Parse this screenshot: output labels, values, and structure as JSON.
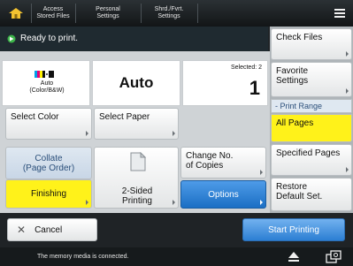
{
  "topbar": {
    "tabs": [
      {
        "label_line1": "Access",
        "label_line2": "Stored Files"
      },
      {
        "label_line1": "Personal",
        "label_line2": "Settings"
      },
      {
        "label_line1": "Shrd./Fvrt.",
        "label_line2": "Settings"
      }
    ]
  },
  "status": {
    "text": "Ready to print."
  },
  "color_panel": {
    "label_line1": "Auto",
    "label_line2": "(Color/B&W)"
  },
  "paper_value": "Auto",
  "copies_panel": {
    "selected_label": "Selected: 2",
    "copies_value": "1"
  },
  "buttons": {
    "select_color": "Select Color",
    "select_paper": "Select Paper",
    "collate_line1": "Collate",
    "collate_line2": "(Page Order)",
    "finishing": "Finishing",
    "two_sided_line1": "2-Sided",
    "two_sided_line2": "Printing",
    "change_copies_line1": "Change No.",
    "change_copies_line2": "of Copies",
    "options": "Options",
    "cancel": "Cancel",
    "start_printing": "Start Printing"
  },
  "right_panel": {
    "check_files": "Check Files",
    "favorite_line1": "Favorite",
    "favorite_line2": "Settings",
    "print_range_header": "Print Range",
    "all_pages": "All Pages",
    "specified_pages": "Specified Pages",
    "restore_line1": "Restore",
    "restore_line2": "Default Set."
  },
  "footer": {
    "message": "The memory media is connected."
  },
  "colors": {
    "accent_yellow": "#fff21a",
    "options_blue": "#1f78d1",
    "start_blue": "#3c8fe0"
  }
}
